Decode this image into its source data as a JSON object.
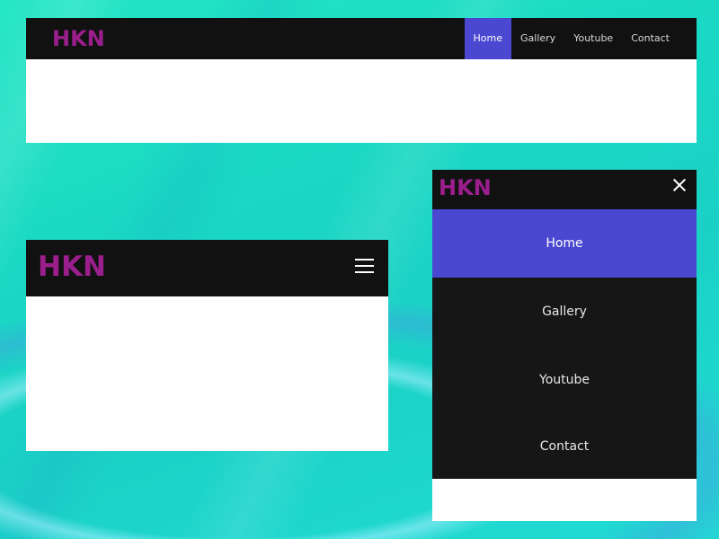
{
  "brand": {
    "logo_text": "HKN",
    "logo_color": "#9b1e8d"
  },
  "colors": {
    "navbar": "#111111",
    "active": "#4a47d1",
    "background": "#1dd9c4"
  },
  "nav": {
    "items": [
      {
        "label": "Home",
        "active": true
      },
      {
        "label": "Gallery",
        "active": false
      },
      {
        "label": "Youtube",
        "active": false
      },
      {
        "label": "Contact",
        "active": false
      }
    ]
  },
  "icons": {
    "menu_toggle": "hamburger-icon",
    "close": "close-icon"
  }
}
